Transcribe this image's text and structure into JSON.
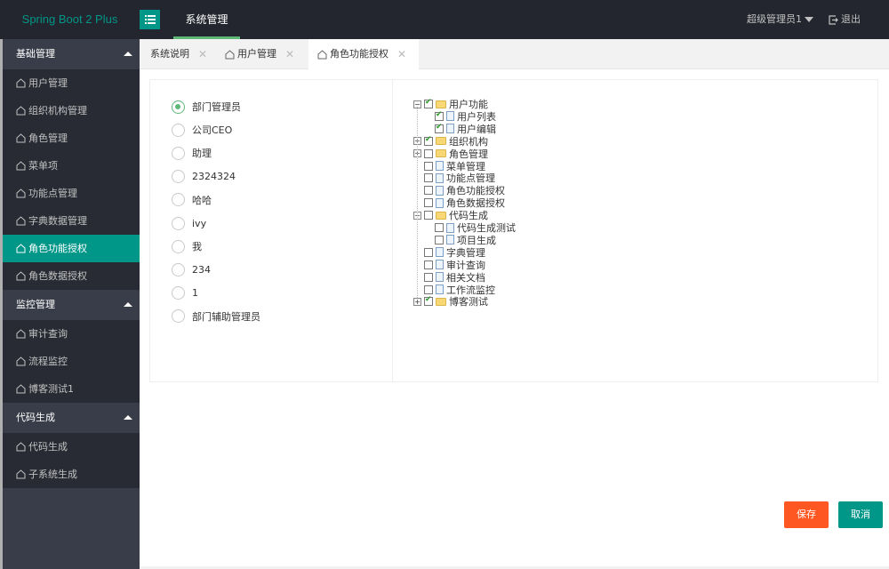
{
  "header": {
    "logo": "Spring Boot 2 Plus",
    "top_nav": [
      {
        "label": "系统管理",
        "active": true
      }
    ],
    "user": "超级管理员1",
    "logout": "退出"
  },
  "sidebar": {
    "groups": [
      {
        "title": "基础管理",
        "expanded": true,
        "items": [
          {
            "label": "用户管理"
          },
          {
            "label": "组织机构管理"
          },
          {
            "label": "角色管理"
          },
          {
            "label": "菜单项"
          },
          {
            "label": "功能点管理"
          },
          {
            "label": "字典数据管理"
          },
          {
            "label": "角色功能授权",
            "active": true
          },
          {
            "label": "角色数据授权"
          }
        ]
      },
      {
        "title": "监控管理",
        "expanded": true,
        "items": [
          {
            "label": "审计查询"
          },
          {
            "label": "流程监控"
          },
          {
            "label": "博客测试1"
          }
        ]
      },
      {
        "title": "代码生成",
        "expanded": true,
        "items": [
          {
            "label": "代码生成"
          },
          {
            "label": "子系统生成"
          }
        ]
      }
    ]
  },
  "tabs": [
    {
      "label": "系统说明",
      "icon": false,
      "active": false
    },
    {
      "label": "用户管理",
      "icon": true,
      "active": false
    },
    {
      "label": "角色功能授权",
      "icon": true,
      "active": true
    }
  ],
  "roles": [
    {
      "label": "部门管理员",
      "checked": true
    },
    {
      "label": "公司CEO",
      "checked": false
    },
    {
      "label": "助理",
      "checked": false
    },
    {
      "label": "2324324",
      "checked": false
    },
    {
      "label": "哈哈",
      "checked": false
    },
    {
      "label": "ivy",
      "checked": false
    },
    {
      "label": "我",
      "checked": false
    },
    {
      "label": "234",
      "checked": false
    },
    {
      "label": "1",
      "checked": false
    },
    {
      "label": "部门辅助管理员",
      "checked": false
    }
  ],
  "tree": [
    {
      "label": "用户功能",
      "level": 0,
      "type": "folder",
      "switch": "minus",
      "checked": true
    },
    {
      "label": "用户列表",
      "level": 1,
      "type": "file",
      "checked": true
    },
    {
      "label": "用户编辑",
      "level": 1,
      "type": "file",
      "checked": true
    },
    {
      "label": "组织机构",
      "level": 0,
      "type": "folder",
      "switch": "plus",
      "checked": true
    },
    {
      "label": "角色管理",
      "level": 0,
      "type": "folder",
      "switch": "plus",
      "checked": false
    },
    {
      "label": "菜单管理",
      "level": 0,
      "type": "file",
      "checked": false
    },
    {
      "label": "功能点管理",
      "level": 0,
      "type": "file",
      "checked": false
    },
    {
      "label": "角色功能授权",
      "level": 0,
      "type": "file",
      "checked": false
    },
    {
      "label": "角色数据授权",
      "level": 0,
      "type": "file",
      "checked": false
    },
    {
      "label": "代码生成",
      "level": 0,
      "type": "folder",
      "switch": "minus",
      "checked": false
    },
    {
      "label": "代码生成测试",
      "level": 1,
      "type": "file",
      "checked": false
    },
    {
      "label": "项目生成",
      "level": 1,
      "type": "file",
      "checked": false
    },
    {
      "label": "字典管理",
      "level": 0,
      "type": "file",
      "checked": false
    },
    {
      "label": "审计查询",
      "level": 0,
      "type": "file",
      "checked": false
    },
    {
      "label": "相关文档",
      "level": 0,
      "type": "file",
      "checked": false
    },
    {
      "label": "工作流监控",
      "level": 0,
      "type": "file",
      "checked": false
    },
    {
      "label": "博客测试",
      "level": 0,
      "type": "folder",
      "switch": "plus",
      "checked": true
    }
  ],
  "actions": {
    "save": "保存",
    "cancel": "取消"
  },
  "colors": {
    "accent": "#009688",
    "save": "#ff5722",
    "radio_checked": "#5fb878",
    "header_bg": "#23262e",
    "sidebar_bg": "#393d49"
  }
}
